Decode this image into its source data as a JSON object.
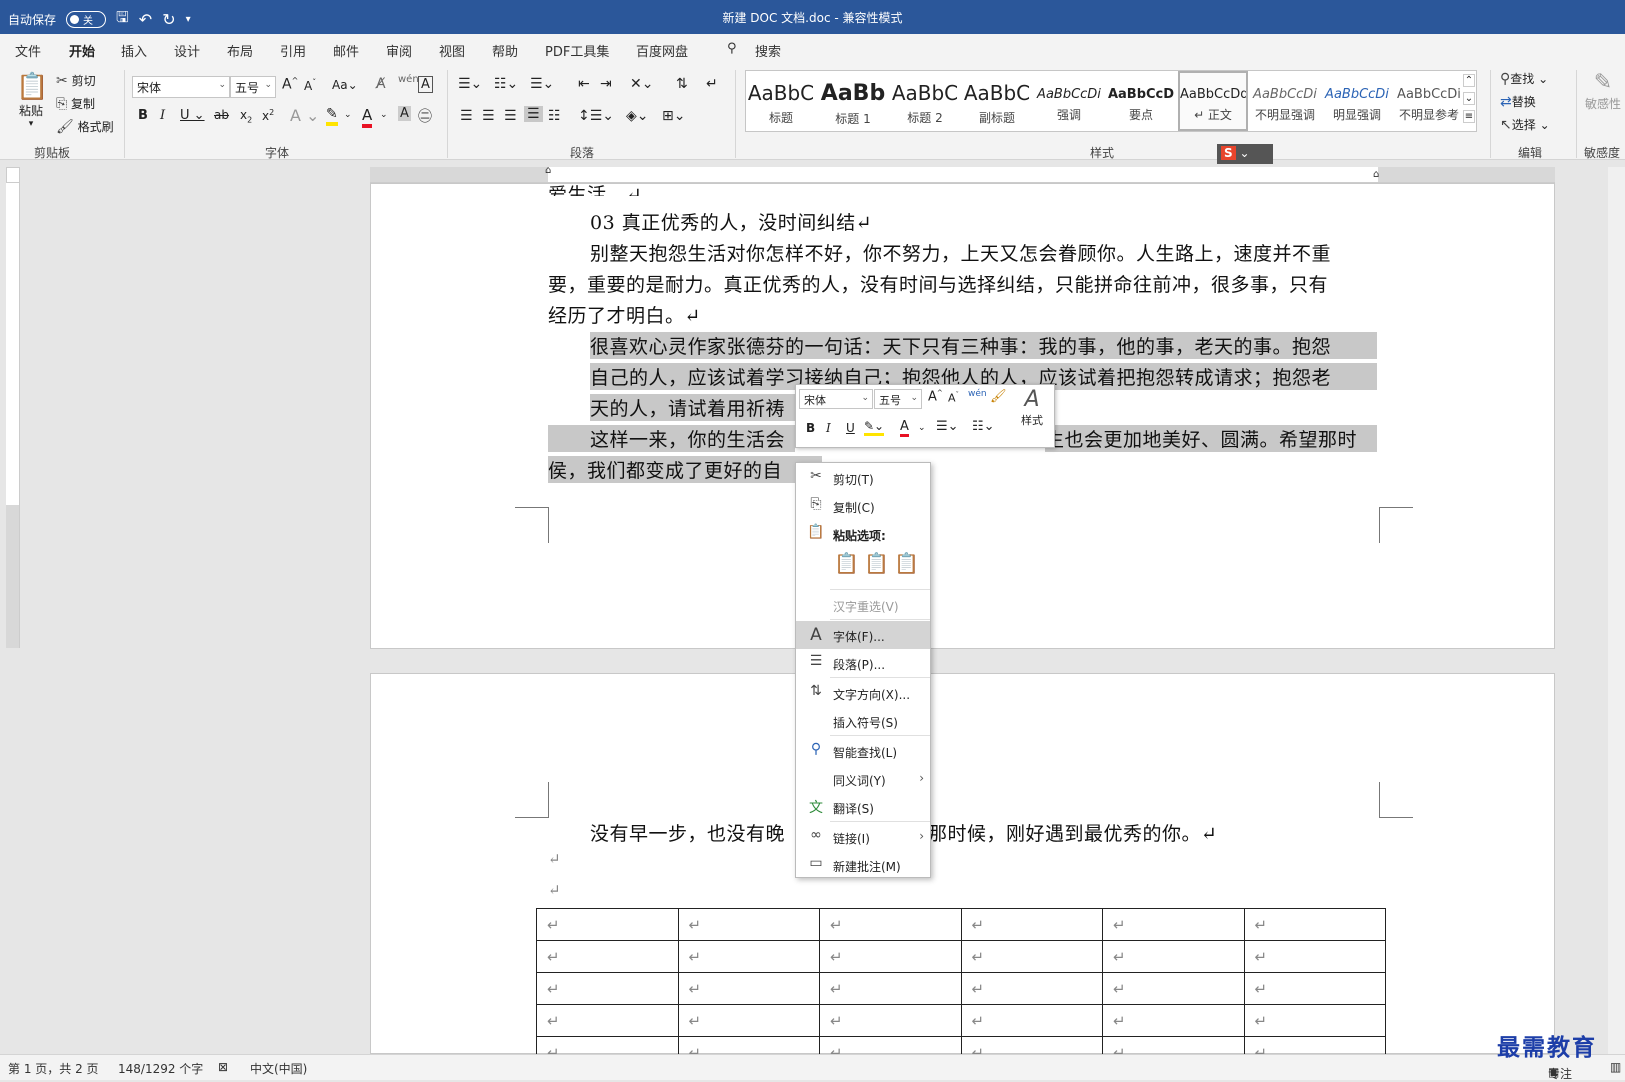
{
  "titlebar": {
    "autosave_label": "自动保存",
    "autosave_state": "关",
    "doc_title": "新建 DOC 文档.doc  -  兼容性模式"
  },
  "menu": {
    "tabs": [
      "文件",
      "开始",
      "插入",
      "设计",
      "布局",
      "引用",
      "邮件",
      "审阅",
      "视图",
      "帮助",
      "PDF工具集",
      "百度网盘"
    ],
    "search": "搜索",
    "active": "开始"
  },
  "ribbon": {
    "clipboard": {
      "paste": "粘贴",
      "cut": "剪切",
      "copy": "复制",
      "format_painter": "格式刷",
      "label": "剪贴板"
    },
    "font": {
      "name": "宋体",
      "size": "五号",
      "aa": "Aa",
      "label": "字体"
    },
    "paragraph": {
      "label": "段落"
    },
    "styles": {
      "label": "样式",
      "items": [
        {
          "sample": "AaBbC",
          "name": "标题"
        },
        {
          "sample": "AaBb",
          "name": "标题 1"
        },
        {
          "sample": "AaBbC",
          "name": "标题 2"
        },
        {
          "sample": "AaBbC",
          "name": "副标题"
        },
        {
          "sample": "AaBbCcDi",
          "name": "强调"
        },
        {
          "sample": "AaBbCcD",
          "name": "要点"
        },
        {
          "sample": "AaBbCcDd",
          "name": "↵ 正文"
        },
        {
          "sample": "AaBbCcDi",
          "name": "不明显强调"
        },
        {
          "sample": "AaBbCcDi",
          "name": "明显强调"
        },
        {
          "sample": "AaBbCcDi",
          "name": "不明显参考"
        }
      ]
    },
    "editing": {
      "find": "查找",
      "replace": "替换",
      "select": "选择",
      "label": "编辑"
    },
    "sensitivity": {
      "name": "敏感性",
      "label": "敏感度"
    }
  },
  "document": {
    "page1_lines": [
      {
        "text": "爱生活。↵",
        "indent": false,
        "hl": false
      },
      {
        "text": "03  真正优秀的人，没时间纠结↵",
        "indent": true,
        "hl": false
      },
      {
        "text": "别整天抱怨生活对你怎样不好，你不努力，上天又怎会眷顾你。人生路上，速度并不重",
        "indent": true,
        "hl": false
      },
      {
        "text": "要，重要的是耐力。真正优秀的人，没有时间与选择纠结，只能拼命往前冲，很多事，只有",
        "indent": false,
        "hl": false
      },
      {
        "text": "经历了才明白。↵",
        "indent": false,
        "hl": false
      },
      {
        "text": "很喜欢心灵作家张德芬的一句话：天下只有三种事：我的事，他的事，老天的事。抱怨",
        "indent": true,
        "hl": true
      },
      {
        "text": "自己的人，应该试着学习接纳自己；抱怨他人的人，应该试着把抱怨转成请求；抱怨老",
        "indent": false,
        "hl": true
      },
      {
        "text": "天的人，请试着用祈祷",
        "indent": false,
        "hl": true
      },
      {
        "text": "这样一来，你的生活会",
        "indent": true,
        "hl": true
      },
      {
        "text": "侯，我们都变成了更好的自",
        "indent": false,
        "hl": true
      }
    ],
    "line9_tail": "生也会更加地美好、圆满。希望那时",
    "page2_line": "没有早一步，也没有晚",
    "page2_tail": "那时候，刚好遇到最优秀的你。↵",
    "para_mark": "↵",
    "table_cell": "↵"
  },
  "mini_toolbar": {
    "font": "宋体",
    "size": "五号",
    "styles_label": "样式"
  },
  "context_menu": {
    "items": [
      {
        "label": "剪切(T)",
        "icon": "scissors-icon"
      },
      {
        "label": "复制(C)",
        "icon": "copy-icon"
      },
      {
        "label": "粘贴选项:",
        "icon": "clipboard-icon"
      },
      {
        "label": "汉字重选(V)",
        "icon": ""
      },
      {
        "label": "字体(F)...",
        "icon": "font-a-icon"
      },
      {
        "label": "段落(P)...",
        "icon": "paragraph-icon"
      },
      {
        "label": "文字方向(X)...",
        "icon": "text-direction-icon"
      },
      {
        "label": "插入符号(S)",
        "icon": ""
      },
      {
        "label": "智能查找(L)",
        "icon": "smart-lookup-icon"
      },
      {
        "label": "同义词(Y)",
        "icon": ""
      },
      {
        "label": "翻译(S)",
        "icon": "translate-icon"
      },
      {
        "label": "链接(I)",
        "icon": "link-icon"
      },
      {
        "label": "新建批注(M)",
        "icon": "comment-icon"
      }
    ]
  },
  "statusbar": {
    "page": "第 1 页，共 2 页",
    "words": "148/1292 个字",
    "lang": "中文(中国)",
    "focus": "专注"
  },
  "watermark": "最需教育"
}
